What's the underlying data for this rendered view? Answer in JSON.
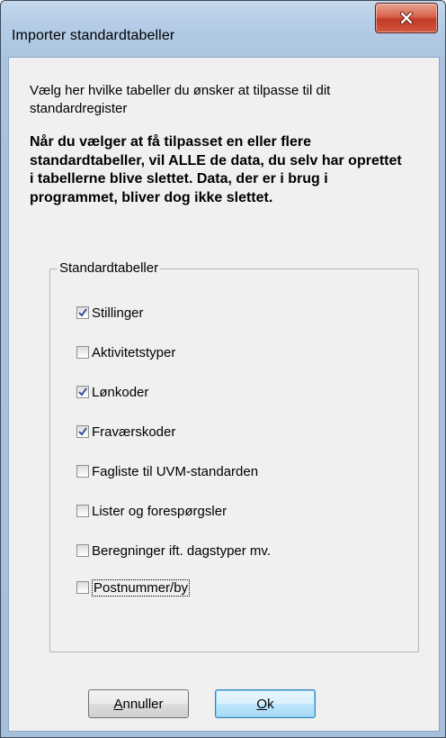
{
  "window": {
    "title": "Importer standardtabeller",
    "close_icon": "close-x-icon",
    "accent_close": "#c7402a",
    "frame_color": "#a9c3df"
  },
  "intro_text": "Vælg her hvilke tabeller du ønsker at tilpasse til dit standardregister",
  "warning_text": "Når du vælger at få tilpasset en eller flere standardtabeller, vil ALLE de data, du selv har oprettet i tabellerne blive slettet. Data, der er i brug i programmet, bliver dog ikke slettet.",
  "group": {
    "label": "Standardtabeller",
    "options": [
      {
        "label": "Stillinger",
        "checked": true
      },
      {
        "label": "Aktivitetstyper",
        "checked": false
      },
      {
        "label": "Lønkoder",
        "checked": true
      },
      {
        "label": "Fraværskoder",
        "checked": true
      },
      {
        "label": "Fagliste til UVM-standarden",
        "checked": false
      },
      {
        "label": "Lister og forespørgsler",
        "checked": false
      },
      {
        "label": "Beregninger ift. dagstyper mv.",
        "checked": false
      },
      {
        "label": "Postnummer/by",
        "checked": false,
        "focused": true
      }
    ]
  },
  "buttons": {
    "cancel": {
      "first": "A",
      "rest": "nnuller"
    },
    "ok": {
      "first": "O",
      "rest": "k"
    }
  }
}
